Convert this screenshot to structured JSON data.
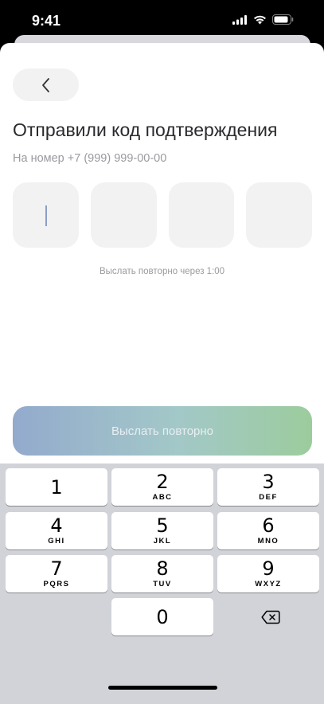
{
  "status_bar": {
    "time": "9:41"
  },
  "back_button": {
    "icon": "chevron-left-icon"
  },
  "title": "Отправили код подтверждения",
  "subtitle": "На номер +7 (999) 999-00-00",
  "code_fields": [
    "",
    "",
    "",
    ""
  ],
  "resend_hint": "Выслать повторно через 1:00",
  "resend_button": {
    "label": "Выслать повторно"
  },
  "keyboard": {
    "keys": [
      {
        "digit": "1",
        "letters": ""
      },
      {
        "digit": "2",
        "letters": "ABC"
      },
      {
        "digit": "3",
        "letters": "DEF"
      },
      {
        "digit": "4",
        "letters": "GHI"
      },
      {
        "digit": "5",
        "letters": "JKL"
      },
      {
        "digit": "6",
        "letters": "MNO"
      },
      {
        "digit": "7",
        "letters": "PQRS"
      },
      {
        "digit": "8",
        "letters": "TUV"
      },
      {
        "digit": "9",
        "letters": "WXYZ"
      },
      {
        "digit": "0",
        "letters": ""
      }
    ],
    "delete_icon": "backspace-icon"
  },
  "colors": {
    "accent_start": "#93aacd",
    "accent_end": "#9ccc9d",
    "field_bg": "#f2f2f3",
    "keyboard_bg": "#d1d3d9"
  }
}
